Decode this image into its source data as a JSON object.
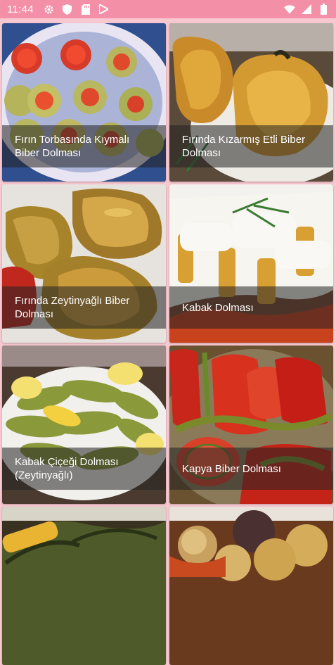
{
  "status_bar": {
    "time": "11:44",
    "left_icons": [
      "gear-icon",
      "shield-icon",
      "sd-card-icon",
      "play-store-icon"
    ],
    "right_icons": [
      "wifi-icon",
      "signal-icon",
      "battery-icon"
    ],
    "background": "#f48fa8"
  },
  "recipes": [
    {
      "title": "Fırın Torbasında Kıymalı Biber Dolması"
    },
    {
      "title": "Fırında Kızarmış Etli Biber Dolması"
    },
    {
      "title": "Fırında Zeytinyağlı Biber Dolması"
    },
    {
      "title": "Kabak Dolması"
    },
    {
      "title": "Kabak Çiçeği Dolması (Zeytinyağlı)"
    },
    {
      "title": "Kapya Biber Dolması"
    },
    {
      "title": ""
    },
    {
      "title": ""
    }
  ],
  "colors": {
    "page_background": "#f8c8d0",
    "caption_overlay": "rgba(35,35,35,0.55)"
  }
}
